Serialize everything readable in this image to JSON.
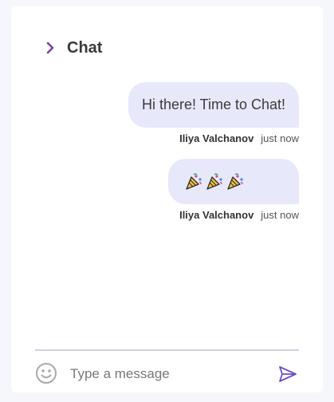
{
  "header": {
    "title": "Chat",
    "chevron_icon": "chevron-right-icon",
    "accent_color": "#7b3fa8"
  },
  "messages": [
    {
      "text": "Hi there! Time to Chat!",
      "author": "Iliya Valchanov",
      "time": "just now"
    },
    {
      "emojis": [
        "party-popper-icon",
        "party-popper-icon",
        "party-popper-icon"
      ],
      "author": "Iliya Valchanov",
      "time": "just now"
    }
  ],
  "bubble_color": "#e8e8fb",
  "composer": {
    "placeholder": "Type a message",
    "emoji_icon": "smiley-icon",
    "send_icon": "send-icon",
    "send_color": "#6c4cc9"
  }
}
